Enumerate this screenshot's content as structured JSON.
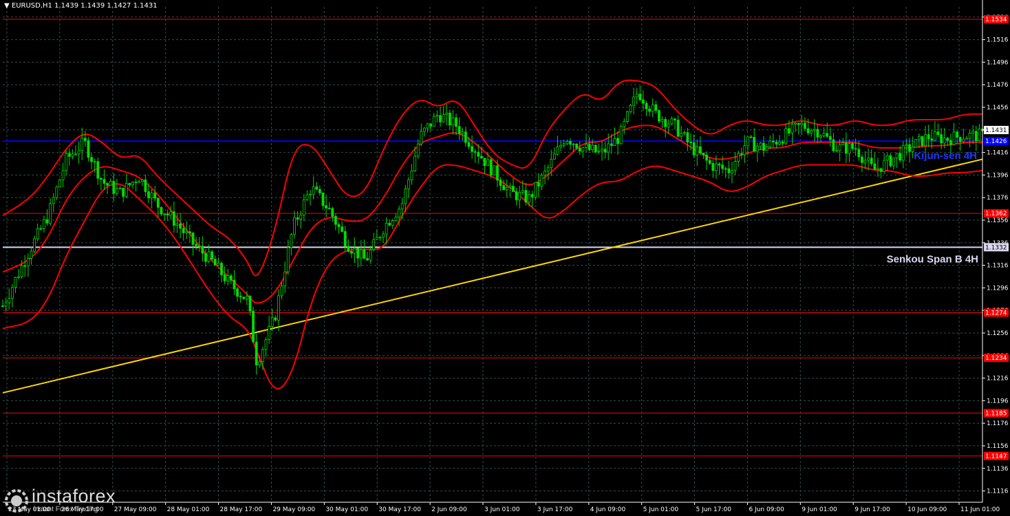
{
  "header": {
    "symbol": "EURUSD,H1",
    "ohlc": "1.1439 1.1439 1.1427 1.1431"
  },
  "logo": {
    "brand": "instaforex",
    "tagline": "Instant Forex Trading"
  },
  "colors": {
    "background": "#000000",
    "grid": "#2f4f4f",
    "candle": "#00dd00",
    "bollinger": "#ff0000",
    "support_resistance": "#ff0000",
    "kijun": "#0000ff",
    "senkou": "#dcd8f0",
    "trendline": "#ffd700",
    "axis_text": "#ffffff",
    "kijun_label": "#1a3cff"
  },
  "chart_data": {
    "type": "line",
    "title": "EURUSD,H1",
    "ylim": [
      1.1106,
      1.1545
    ],
    "y_ticks": [
      "1.1536",
      "1.1516",
      "1.1496",
      "1.1476",
      "1.1456",
      "1.1436",
      "1.1416",
      "1.1396",
      "1.1376",
      "1.1356",
      "1.1336",
      "1.1316",
      "1.1296",
      "1.1276",
      "1.1256",
      "1.1236",
      "1.1216",
      "1.1196",
      "1.1176",
      "1.1156",
      "1.1136",
      "1.1116"
    ],
    "x_ticks": [
      "23 May 01:00",
      "26 May 17:00",
      "27 May 09:00",
      "28 May 01:00",
      "28 May 17:00",
      "29 May 09:00",
      "30 May 01:00",
      "30 May 17:00",
      "2 Jun 09:00",
      "3 Jun 01:00",
      "3 Jun 17:00",
      "4 Jun 09:00",
      "5 Jun 01:00",
      "5 Jun 17:00",
      "6 Jun 09:00",
      "9 Jun 01:00",
      "9 Jun 17:00",
      "10 Jun 09:00",
      "11 Jun 01:00"
    ],
    "horizontal_levels": [
      {
        "value": 1.1534,
        "label": "1.1534",
        "kind": "resistance"
      },
      {
        "value": 1.1426,
        "label": "1.1426",
        "kind": "kijun"
      },
      {
        "value": 1.1362,
        "label": "1.1362",
        "kind": "resistance"
      },
      {
        "value": 1.1332,
        "label": "1.1332",
        "kind": "senkou"
      },
      {
        "value": 1.1274,
        "label": "1.1274",
        "kind": "support"
      },
      {
        "value": 1.1234,
        "label": "1.1234",
        "kind": "support"
      },
      {
        "value": 1.1185,
        "label": "1.1185",
        "kind": "support"
      },
      {
        "value": 1.1147,
        "label": "1.1147",
        "kind": "support"
      }
    ],
    "current_price": {
      "value": 1.1431,
      "label": "1.1431"
    },
    "annotations": [
      {
        "text": "Kijun-sen 4H",
        "level": 1.1426
      },
      {
        "text": "Senkou Span B 4H",
        "level": 1.1332
      }
    ],
    "trendline": {
      "x": [
        0,
        108
      ],
      "y": [
        1.1203,
        1.141
      ]
    },
    "price_path": {
      "x": [
        0,
        3,
        5,
        7,
        9,
        11,
        13,
        15,
        17,
        19,
        21,
        23,
        25,
        27,
        28,
        30,
        32,
        34,
        36,
        38,
        40,
        42,
        44,
        46,
        48,
        50,
        52,
        54,
        56,
        58,
        60,
        62,
        64,
        66,
        68,
        70,
        72,
        74,
        76,
        78,
        80,
        82,
        84,
        86,
        88,
        90,
        92,
        94,
        96,
        98,
        100,
        102,
        104,
        106,
        108
      ],
      "y": [
        1.128,
        1.133,
        1.136,
        1.141,
        1.1425,
        1.139,
        1.138,
        1.1395,
        1.137,
        1.1355,
        1.1335,
        1.132,
        1.13,
        1.1285,
        1.123,
        1.127,
        1.135,
        1.1385,
        1.1365,
        1.1335,
        1.132,
        1.135,
        1.137,
        1.143,
        1.145,
        1.144,
        1.142,
        1.14,
        1.138,
        1.1375,
        1.14,
        1.143,
        1.142,
        1.1415,
        1.143,
        1.147,
        1.145,
        1.144,
        1.142,
        1.1405,
        1.14,
        1.1425,
        1.142,
        1.143,
        1.144,
        1.1435,
        1.142,
        1.142,
        1.14,
        1.141,
        1.142,
        1.143,
        1.1428,
        1.1431,
        1.1431
      ]
    },
    "bollinger": {
      "x": [
        0,
        3,
        5,
        7,
        9,
        11,
        13,
        15,
        17,
        19,
        21,
        23,
        25,
        27,
        28,
        30,
        32,
        34,
        36,
        38,
        40,
        42,
        44,
        46,
        48,
        50,
        52,
        54,
        56,
        58,
        60,
        62,
        64,
        66,
        68,
        70,
        72,
        74,
        76,
        78,
        80,
        82,
        84,
        86,
        88,
        90,
        92,
        94,
        96,
        98,
        100,
        102,
        104,
        106,
        108
      ],
      "upper": [
        1.136,
        1.1375,
        1.1395,
        1.142,
        1.1435,
        1.1425,
        1.141,
        1.1415,
        1.1395,
        1.138,
        1.1365,
        1.135,
        1.134,
        1.132,
        1.13,
        1.1345,
        1.142,
        1.1425,
        1.14,
        1.1375,
        1.138,
        1.142,
        1.145,
        1.1465,
        1.1455,
        1.1465,
        1.144,
        1.1415,
        1.1405,
        1.14,
        1.1435,
        1.1455,
        1.147,
        1.146,
        1.148,
        1.148,
        1.1475,
        1.1455,
        1.144,
        1.143,
        1.144,
        1.1445,
        1.144,
        1.144,
        1.1445,
        1.144,
        1.144,
        1.1445,
        1.144,
        1.144,
        1.1445,
        1.1445,
        1.1445,
        1.145,
        1.145
      ],
      "middle": [
        1.131,
        1.132,
        1.134,
        1.1375,
        1.1395,
        1.1405,
        1.14,
        1.1395,
        1.138,
        1.136,
        1.134,
        1.132,
        1.1305,
        1.129,
        1.128,
        1.129,
        1.132,
        1.135,
        1.136,
        1.1355,
        1.1355,
        1.1375,
        1.1405,
        1.1425,
        1.143,
        1.1435,
        1.1425,
        1.141,
        1.1395,
        1.1385,
        1.1395,
        1.141,
        1.1425,
        1.1425,
        1.1435,
        1.144,
        1.144,
        1.143,
        1.142,
        1.141,
        1.141,
        1.1415,
        1.142,
        1.142,
        1.1425,
        1.1425,
        1.1425,
        1.1425,
        1.142,
        1.142,
        1.142,
        1.1422,
        1.1422,
        1.1425,
        1.1425
      ],
      "lower": [
        1.126,
        1.1265,
        1.1285,
        1.1325,
        1.1355,
        1.1385,
        1.139,
        1.1375,
        1.136,
        1.134,
        1.1315,
        1.129,
        1.127,
        1.126,
        1.124,
        1.12,
        1.122,
        1.1285,
        1.132,
        1.133,
        1.133,
        1.133,
        1.136,
        1.1385,
        1.1405,
        1.1405,
        1.14,
        1.1395,
        1.1385,
        1.137,
        1.1355,
        1.1365,
        1.138,
        1.139,
        1.139,
        1.14,
        1.1405,
        1.14,
        1.1395,
        1.139,
        1.138,
        1.1385,
        1.1395,
        1.14,
        1.1405,
        1.1405,
        1.1405,
        1.1405,
        1.14,
        1.14,
        1.1395,
        1.1395,
        1.1398,
        1.1398,
        1.14
      ]
    }
  }
}
